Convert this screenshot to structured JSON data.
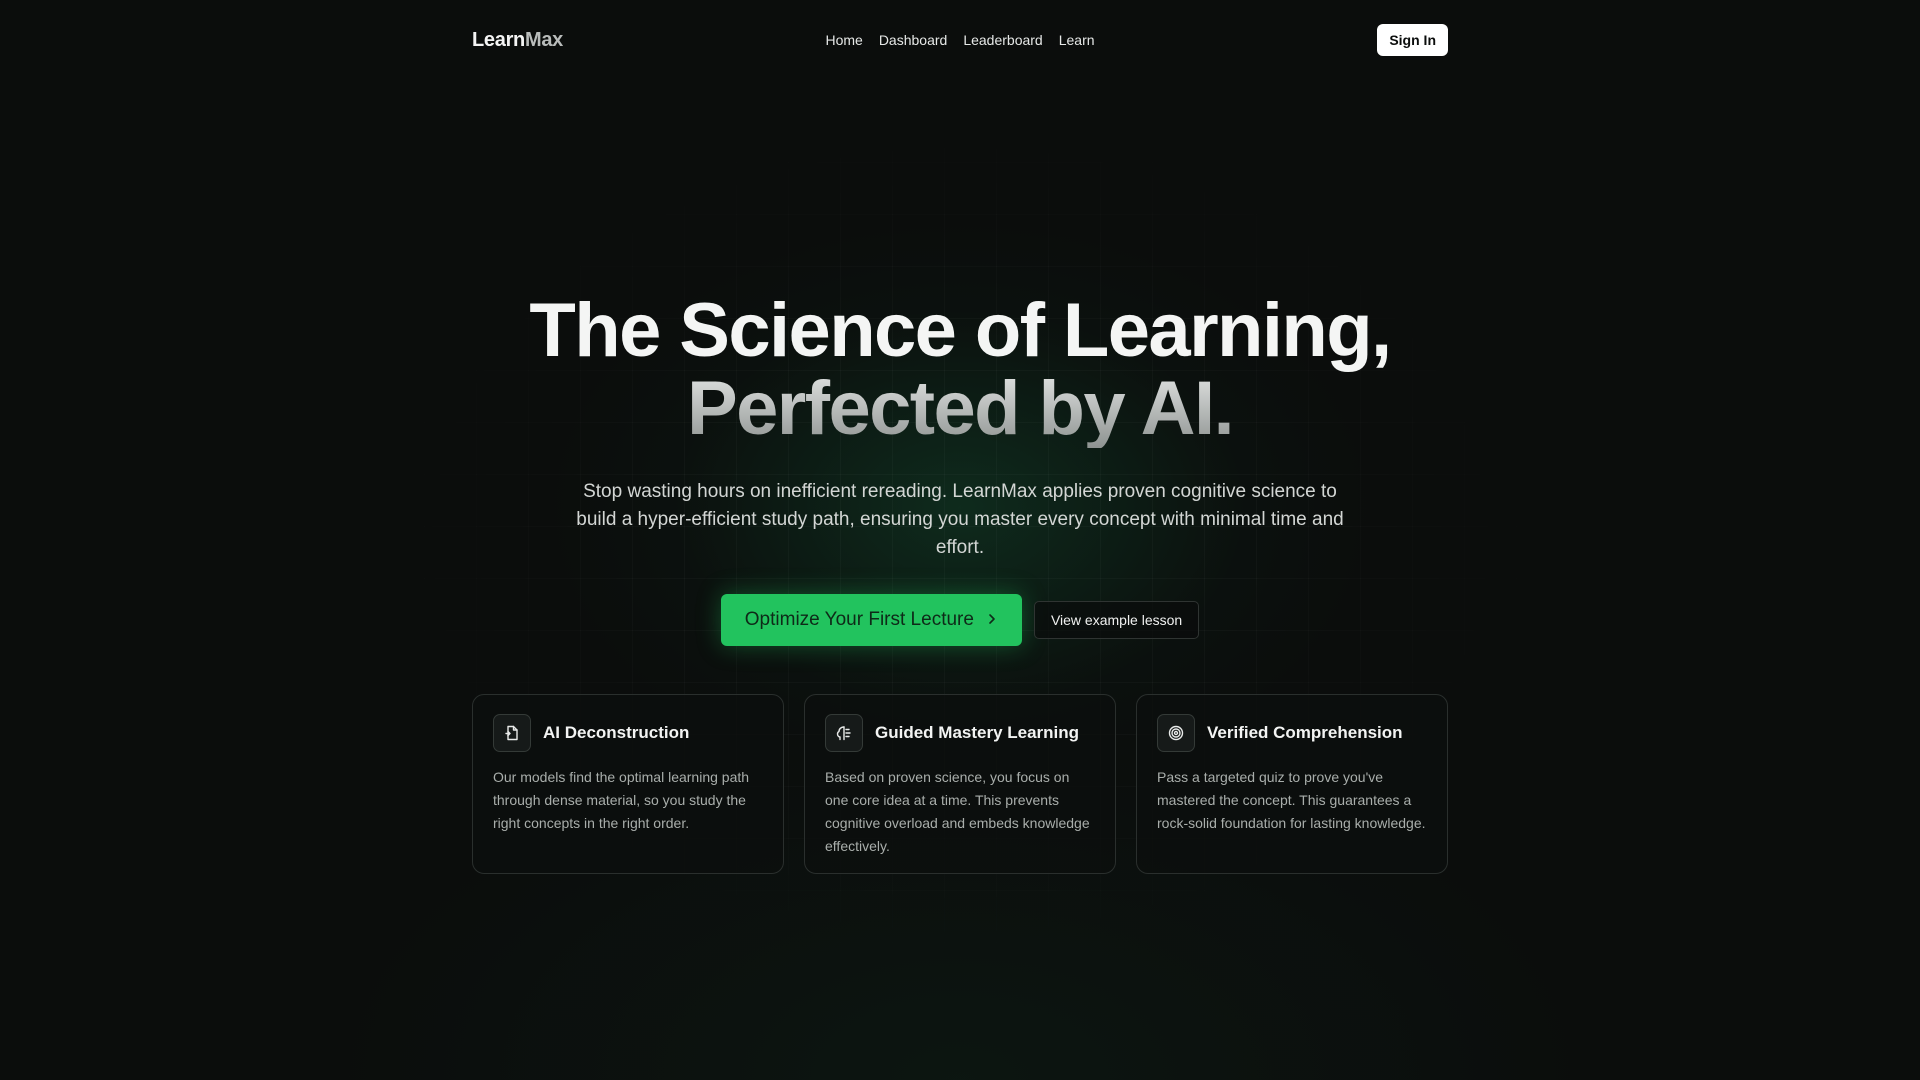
{
  "nav": {
    "logo_main": "Learn",
    "logo_accent": "Max",
    "links": [
      "Home",
      "Dashboard",
      "Leaderboard",
      "Learn"
    ],
    "signin_label": "Sign In"
  },
  "hero": {
    "title_line1": "The Science of Learning,",
    "title_line2": "Perfected by AI.",
    "subtitle": "Stop wasting hours on inefficient rereading. LearnMax applies proven cognitive science to build a hyper-efficient study path, ensuring you master every concept with minimal time and effort.",
    "cta_primary": "Optimize Your First Lecture",
    "cta_secondary": "View example lesson"
  },
  "features": [
    {
      "icon": "document-split-icon",
      "title": "AI Deconstruction",
      "text": "Our models find the optimal learning path through dense material, so you study the right concepts in the right order."
    },
    {
      "icon": "brain-icon",
      "title": "Guided Mastery Learning",
      "text": "Based on proven science, you focus on one core idea at a time. This prevents cognitive overload and embeds knowledge effectively."
    },
    {
      "icon": "target-icon",
      "title": "Verified Comprehension",
      "text": "Pass a targeted quiz to prove you've mastered the concept. This guarantees a rock-solid foundation for lasting knowledge."
    }
  ],
  "colors": {
    "background": "#0b0d0c",
    "accent_green": "#22c35e",
    "card_border": "#2a2f2d"
  }
}
